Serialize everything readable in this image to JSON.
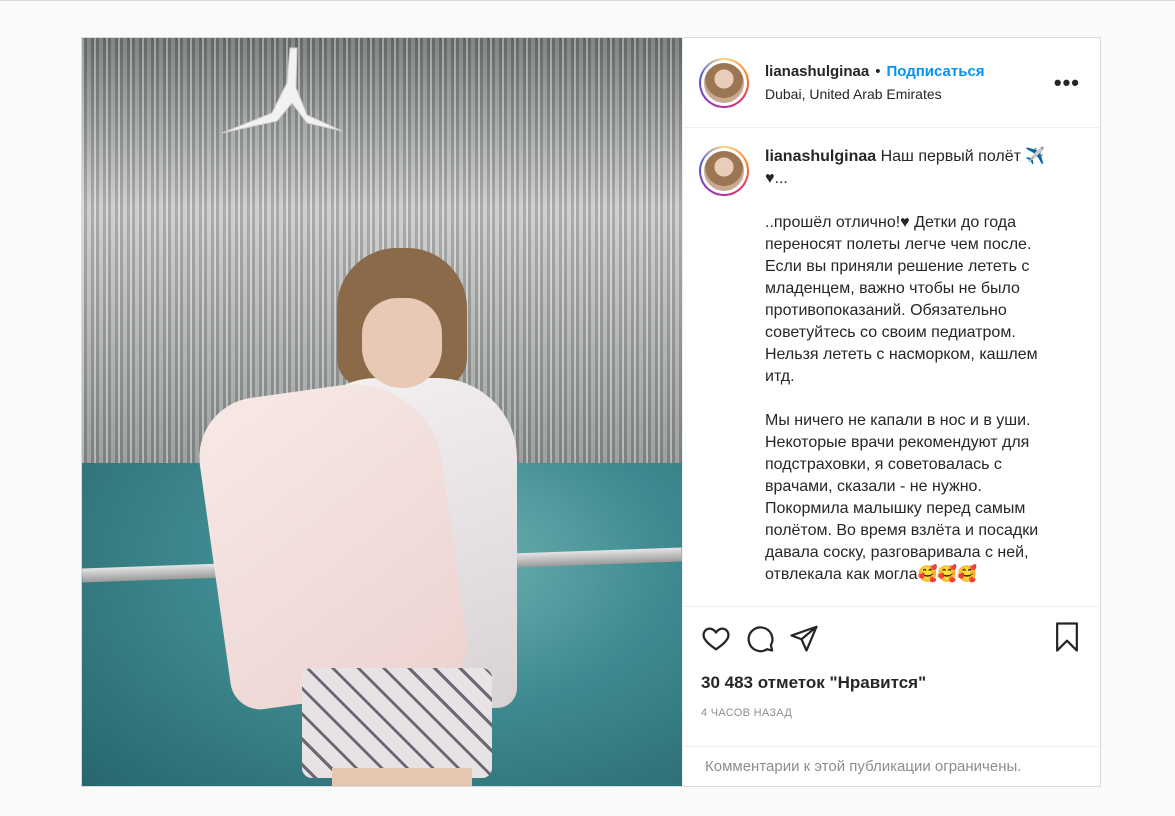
{
  "post": {
    "username": "lianashulginaa",
    "follow_label": "Подписаться",
    "separator": "•",
    "location": "Dubai, United Arab Emirates",
    "more_label": "•••",
    "caption_first_line": "Наш первый полёт ✈️♥...",
    "caption_paragraphs": [
      "..прошёл отлично!♥ Детки до года переносят полеты легче чем после. Если вы приняли решение лететь с младенцем, важно чтобы не было противопоказаний. Обязательно советуйтесь со своим педиатром. Нельзя лететь с насморком, кашлем итд.",
      "Мы ничего не капали в нос и в уши. Некоторые врачи рекомендуют для подстраховки, я советовалась с врачами, сказали - не нужно. Покормила малышку перед самым полётом. Во время взлёта и посадки давала соску, разговаривала с ней, отвлекала как могла🥰🥰🥰"
    ],
    "likes": "30 483 отметок \"Нравится\"",
    "time_ago": "4 ЧАСОВ НАЗАД",
    "comments_disabled": "Комментарии к этой публикации ограничены."
  },
  "icons": {
    "like": "heart-icon",
    "comment": "comment-icon",
    "share": "share-icon",
    "save": "bookmark-icon"
  }
}
